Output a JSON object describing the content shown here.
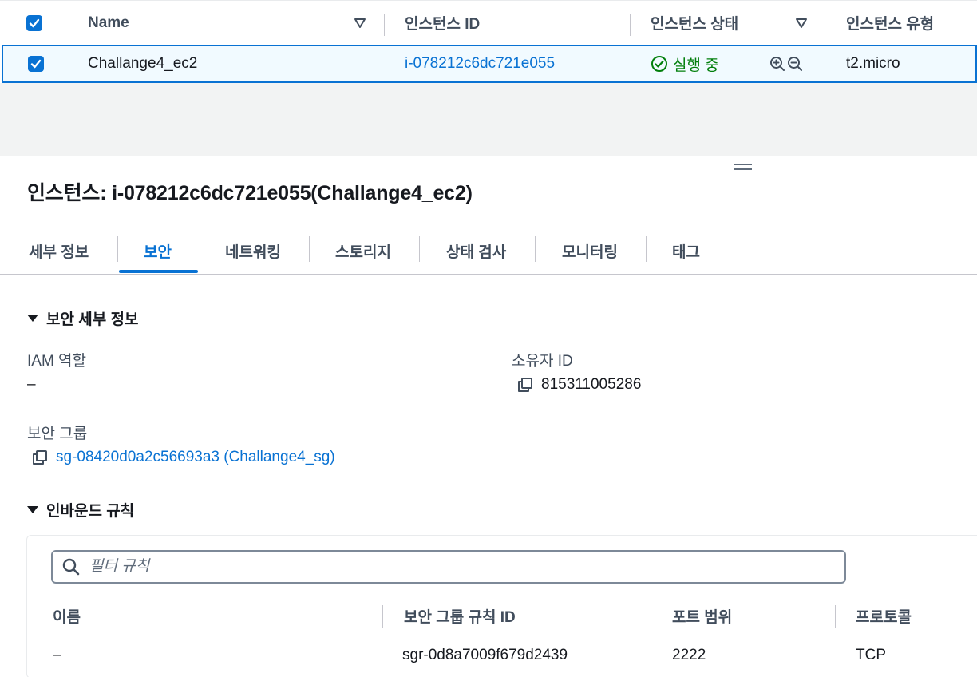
{
  "instances_table": {
    "columns": [
      "Name",
      "인스턴스 ID",
      "인스턴스 상태",
      "인스턴스 유형"
    ],
    "row": {
      "name": "Challange4_ec2",
      "instance_id": "i-078212c6dc721e055",
      "state": "실행 중",
      "type": "t2.micro",
      "selected": true
    }
  },
  "details": {
    "title": "인스턴스: i-078212c6dc721e055(Challange4_ec2)",
    "tabs": [
      "세부 정보",
      "보안",
      "네트워킹",
      "스토리지",
      "상태 검사",
      "모니터링",
      "태그"
    ],
    "active_tab": "보안",
    "security_section": {
      "title": "보안 세부 정보",
      "iam_role_label": "IAM 역할",
      "iam_role_value": "–",
      "owner_id_label": "소유자 ID",
      "owner_id_value": "815311005286",
      "security_group_label": "보안 그룹",
      "security_group_value": "sg-08420d0a2c56693a3 (Challange4_sg)"
    },
    "inbound_section": {
      "title": "인바운드 규칙",
      "filter_placeholder": "필터 규칙",
      "columns": [
        "이름",
        "보안 그룹 규칙 ID",
        "포트 범위",
        "프로토콜"
      ],
      "rows": [
        {
          "name": "–",
          "rule_id": "sgr-0d8a7009f679d2439",
          "port_range": "2222",
          "protocol": "TCP"
        }
      ]
    }
  },
  "colors": {
    "link": "#0972d3",
    "success": "#037f0c",
    "selected_row_bg": "#f1faff",
    "band": "#f2f3f3"
  },
  "icons": [
    "checkbox-checked-icon",
    "sort-caret-icon",
    "status-success-icon",
    "zoom-in-icon",
    "zoom-out-icon",
    "copy-icon",
    "search-icon",
    "caret-down-icon"
  ]
}
